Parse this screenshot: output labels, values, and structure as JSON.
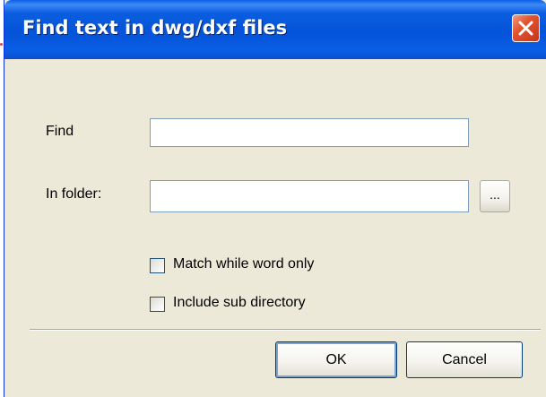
{
  "window": {
    "title": "Find text in dwg/dxf files"
  },
  "form": {
    "find_label": "Find",
    "find_value": "",
    "folder_label": "In folder:",
    "folder_value": "",
    "browse_label": "..."
  },
  "options": {
    "match_whole_word_label": "Match while word only",
    "match_whole_word_checked": false,
    "include_subdir_label": "Include sub directory",
    "include_subdir_checked": false
  },
  "buttons": {
    "ok_label": "OK",
    "cancel_label": "Cancel"
  },
  "colors": {
    "titlebar": "#0553d8",
    "close_button": "#e2532f",
    "dialog_background": "#ece9d8"
  }
}
